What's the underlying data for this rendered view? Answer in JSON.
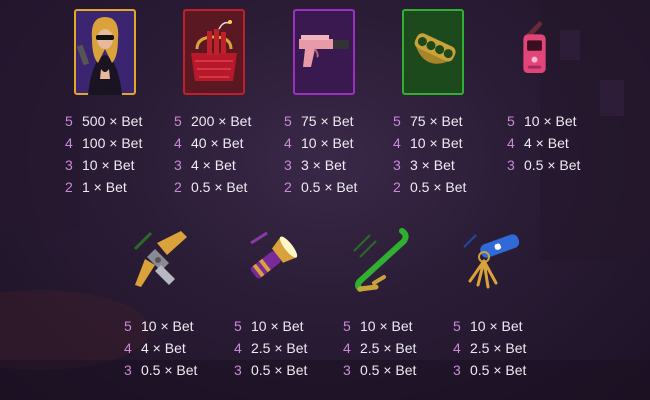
{
  "high_symbols": [
    {
      "name": "Agent",
      "icon": "spy-woman-icon",
      "frame_color": "#e0a82a",
      "pays": [
        {
          "count": "5",
          "mult": "500 × Bet"
        },
        {
          "count": "4",
          "mult": "100 × Bet"
        },
        {
          "count": "3",
          "mult": "10 × Bet"
        },
        {
          "count": "2",
          "mult": "1 × Bet"
        }
      ]
    },
    {
      "name": "Dynamite Bag",
      "icon": "dynamite-bag-icon",
      "frame_color": "#c0202a",
      "pays": [
        {
          "count": "5",
          "mult": "200 × Bet"
        },
        {
          "count": "4",
          "mult": "40 × Bet"
        },
        {
          "count": "3",
          "mult": "4 × Bet"
        },
        {
          "count": "2",
          "mult": "0.5 × Bet"
        }
      ]
    },
    {
      "name": "Pistol",
      "icon": "pistol-icon",
      "frame_color": "#9a2fc0",
      "pays": [
        {
          "count": "5",
          "mult": "75 × Bet"
        },
        {
          "count": "4",
          "mult": "10 × Bet"
        },
        {
          "count": "3",
          "mult": "3 × Bet"
        },
        {
          "count": "2",
          "mult": "0.5 × Bet"
        }
      ]
    },
    {
      "name": "Brass Knuckles",
      "icon": "brass-knuckles-icon",
      "frame_color": "#2fb02f",
      "pays": [
        {
          "count": "5",
          "mult": "75 × Bet"
        },
        {
          "count": "4",
          "mult": "10 × Bet"
        },
        {
          "count": "3",
          "mult": "3 × Bet"
        },
        {
          "count": "2",
          "mult": "0.5 × Bet"
        }
      ]
    }
  ],
  "mid_symbols": [
    {
      "name": "Walkie Talkie",
      "icon": "walkie-talkie-icon",
      "pays": [
        {
          "count": "5",
          "mult": "10 × Bet"
        },
        {
          "count": "4",
          "mult": "4 × Bet"
        },
        {
          "count": "3",
          "mult": "0.5 × Bet"
        }
      ]
    }
  ],
  "low_symbols": [
    {
      "name": "Wire Cutters",
      "icon": "wire-cutters-icon",
      "pays": [
        {
          "count": "5",
          "mult": "10 × Bet"
        },
        {
          "count": "4",
          "mult": "4 × Bet"
        },
        {
          "count": "3",
          "mult": "0.5 × Bet"
        }
      ]
    },
    {
      "name": "Flashlight",
      "icon": "flashlight-icon",
      "pays": [
        {
          "count": "5",
          "mult": "10 × Bet"
        },
        {
          "count": "4",
          "mult": "2.5 × Bet"
        },
        {
          "count": "3",
          "mult": "0.5 × Bet"
        }
      ]
    },
    {
      "name": "Crowbar",
      "icon": "crowbar-icon",
      "pays": [
        {
          "count": "5",
          "mult": "10 × Bet"
        },
        {
          "count": "4",
          "mult": "2.5 × Bet"
        },
        {
          "count": "3",
          "mult": "0.5 × Bet"
        }
      ]
    },
    {
      "name": "Keys",
      "icon": "keys-icon",
      "pays": [
        {
          "count": "5",
          "mult": "10 × Bet"
        },
        {
          "count": "4",
          "mult": "2.5 × Bet"
        },
        {
          "count": "3",
          "mult": "0.5 × Bet"
        }
      ]
    }
  ],
  "colors": {
    "count": "#c98ad8",
    "multiplier": "#efeaf3",
    "background": "#2a1c35"
  }
}
